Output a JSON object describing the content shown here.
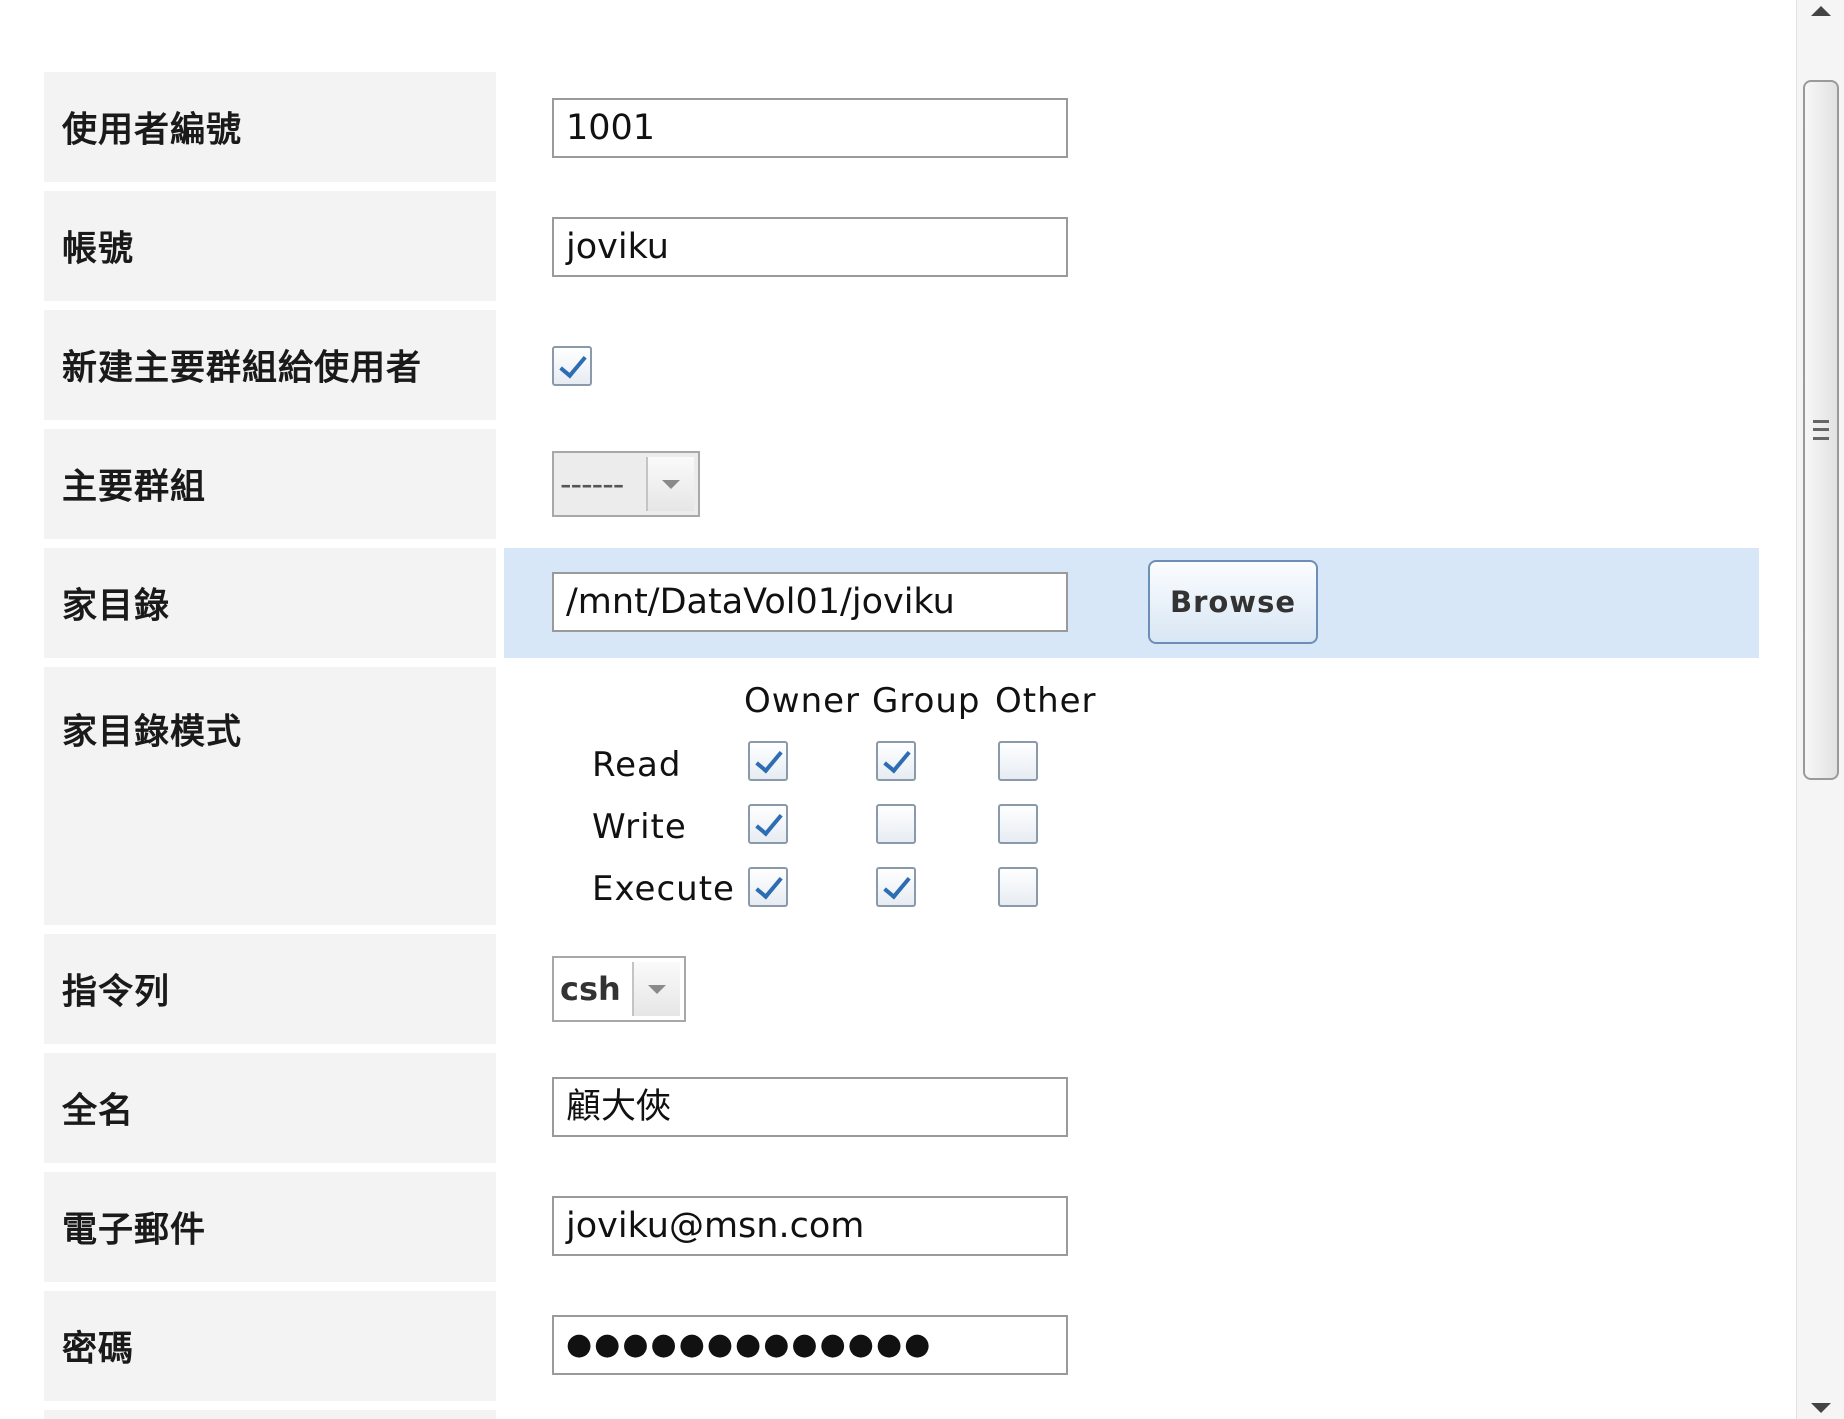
{
  "form": {
    "user_id": {
      "label": "使用者編號",
      "value": "1001"
    },
    "account": {
      "label": "帳號",
      "value": "joviku"
    },
    "create_primary_group": {
      "label": "新建主要群組給使用者",
      "checked": true
    },
    "primary_group": {
      "label": "主要群組",
      "selected": "------"
    },
    "home_dir": {
      "label": "家目錄",
      "value": "/mnt/DataVol01/joviku",
      "browse_label": "Browse"
    },
    "home_mode": {
      "label": "家目錄模式",
      "columns": [
        "Owner",
        "Group",
        "Other"
      ],
      "rows": [
        {
          "name": "Read",
          "owner": true,
          "group": true,
          "other": false
        },
        {
          "name": "Write",
          "owner": true,
          "group": false,
          "other": false
        },
        {
          "name": "Execute",
          "owner": true,
          "group": true,
          "other": false
        }
      ]
    },
    "shell": {
      "label": "指令列",
      "selected": "csh"
    },
    "full_name": {
      "label": "全名",
      "value": "顧大俠"
    },
    "email": {
      "label": "電子郵件",
      "value": "joviku@msn.com"
    },
    "password": {
      "label": "密碼",
      "value": "●●●●●●●●●●●●●"
    }
  },
  "icons": {
    "dropdown": "chevron-down-icon",
    "scroll_up": "arrow-up-icon",
    "scroll_down": "arrow-down-icon",
    "scroll_grip": "grip-icon"
  },
  "colors": {
    "label_bg": "#f3f3f3",
    "highlight_row": "#d7e7f7",
    "check_mark": "#2c6db3"
  }
}
